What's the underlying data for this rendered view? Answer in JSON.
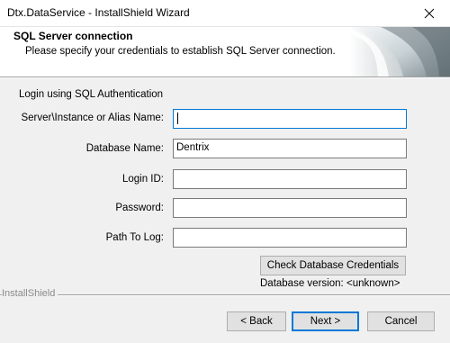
{
  "window": {
    "title": "Dtx.DataService - InstallShield Wizard",
    "close_icon": "close-icon"
  },
  "banner": {
    "title": "SQL Server connection",
    "subtitle": "Please specify your credentials to establish SQL Server connection."
  },
  "form": {
    "group_label": "Login using SQL Authentication",
    "server": {
      "label": "Server\\Instance or Alias Name:",
      "value": ""
    },
    "database": {
      "label": "Database Name:",
      "value": "Dentrix"
    },
    "login": {
      "label": "Login ID:",
      "value": ""
    },
    "password": {
      "label": "Password:",
      "value": ""
    },
    "path": {
      "label": "Path To Log:",
      "value": ""
    },
    "check_button": "Check Database Credentials",
    "db_version_label": "Database version:",
    "db_version_value": "<unknown>"
  },
  "footer": {
    "brand": "InstallShield",
    "back": "< Back",
    "next": "Next >",
    "cancel": "Cancel"
  },
  "colors": {
    "accent": "#0078d7",
    "content_bg": "#f0f0f0",
    "button_bg": "#e1e1e1"
  }
}
